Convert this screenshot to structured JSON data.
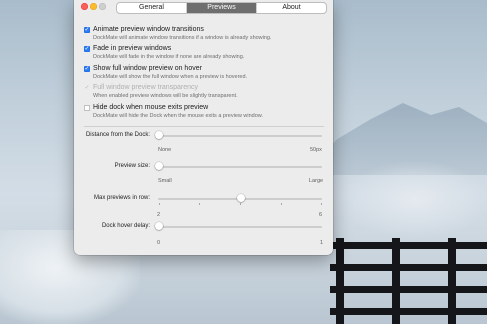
{
  "window": {
    "tabs": [
      {
        "label": "General",
        "selected": false
      },
      {
        "label": "Previews",
        "selected": true
      },
      {
        "label": "About",
        "selected": false
      }
    ]
  },
  "options": [
    {
      "title": "Animate preview window transitions",
      "description": "DockMate will animate window transitions if a window is already showing.",
      "checked": true,
      "enabled": true
    },
    {
      "title": "Fade in preview windows",
      "description": "DockMate will fade in the window if none are already showing.",
      "checked": true,
      "enabled": true
    },
    {
      "title": "Show full window preview on hover",
      "description": "DockMate will show the full window when a preview is hovered.",
      "checked": true,
      "enabled": true
    },
    {
      "title": "Full window preview transparency",
      "description": "When enabled preview windows will be slightly transparent.",
      "checked": true,
      "enabled": false
    },
    {
      "title": "Hide dock when mouse exits preview",
      "description": "DockMate will hide the Dock when the mouse exits a preview window.",
      "checked": false,
      "enabled": true
    }
  ],
  "sliders": [
    {
      "label": "Distance from the Dock:",
      "min_label": "None",
      "max_label": "50px",
      "value": 0.0
    },
    {
      "label": "Preview size:",
      "min_label": "Small",
      "max_label": "Large",
      "value": 0.0
    },
    {
      "label": "Max previews in row:",
      "min_label": "2",
      "max_label": "6",
      "value": 0.5
    },
    {
      "label": "Dock hover delay:",
      "min_label": "0",
      "max_label": "1",
      "value": 0.0
    }
  ],
  "colors": {
    "accent": "#2d7cf6",
    "selected_tab": "#6e6e6e"
  },
  "icons": {
    "check": "✓"
  }
}
